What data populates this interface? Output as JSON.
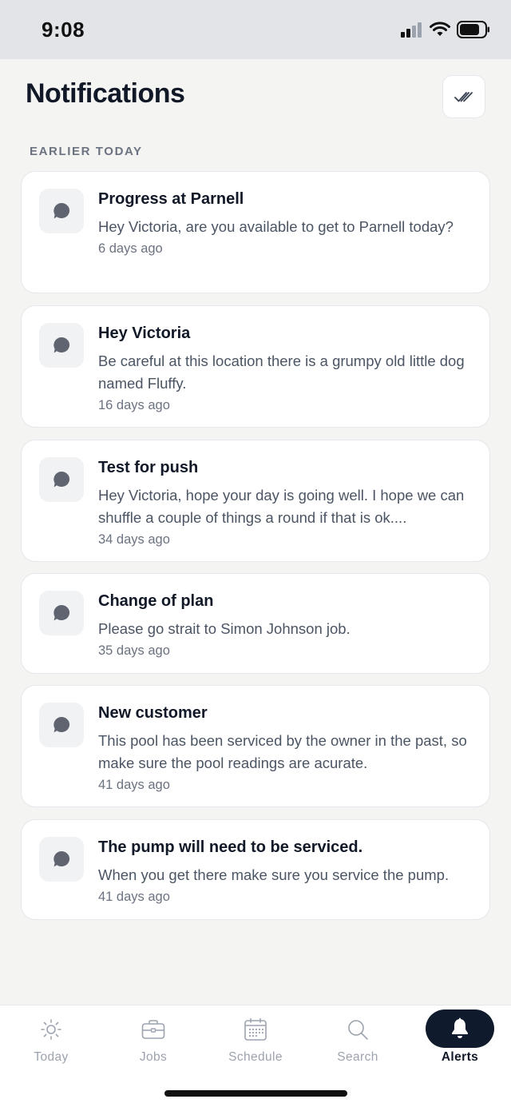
{
  "status_bar": {
    "time": "9:08"
  },
  "header": {
    "title": "Notifications",
    "mark_all_read_icon": "double-check-icon"
  },
  "section": {
    "label": "EARLIER TODAY"
  },
  "notifications": [
    {
      "title": "Progress at Parnell",
      "body": "Hey Victoria, are you available to get to Parnell today?",
      "time": "6 days ago",
      "icon": "chat-bubble-icon"
    },
    {
      "title": "Hey Victoria",
      "body": "Be careful at this location there is a grumpy old little dog named Fluffy.",
      "time": "16 days ago",
      "icon": "chat-bubble-icon"
    },
    {
      "title": "Test for push",
      "body": "Hey Victoria, hope your day is going well. I hope we can shuffle a couple of things a round if that is ok....",
      "time": "34 days ago",
      "icon": "chat-bubble-icon"
    },
    {
      "title": "Change of plan",
      "body": "Please go strait to Simon Johnson job.",
      "time": "35 days ago",
      "icon": "chat-bubble-icon"
    },
    {
      "title": "New customer",
      "body": "This pool has been serviced by the owner in the past, so make sure the pool readings are acurate.",
      "time": "41 days ago",
      "icon": "chat-bubble-icon"
    },
    {
      "title": "The pump will need to be serviced.",
      "body": "When you get there make sure you service the pump.",
      "time": "41 days ago",
      "icon": "chat-bubble-icon"
    }
  ],
  "bottom_nav": {
    "items": [
      {
        "label": "Today",
        "icon": "sun-icon"
      },
      {
        "label": "Jobs",
        "icon": "briefcase-icon"
      },
      {
        "label": "Schedule",
        "icon": "calendar-icon"
      },
      {
        "label": "Search",
        "icon": "search-icon"
      },
      {
        "label": "Alerts",
        "icon": "bell-icon"
      }
    ],
    "active": "Alerts"
  },
  "colors": {
    "background": "#f4f4f2",
    "card": "#ffffff",
    "active_pill": "#0f1b2d",
    "muted_text": "#6b7280"
  }
}
